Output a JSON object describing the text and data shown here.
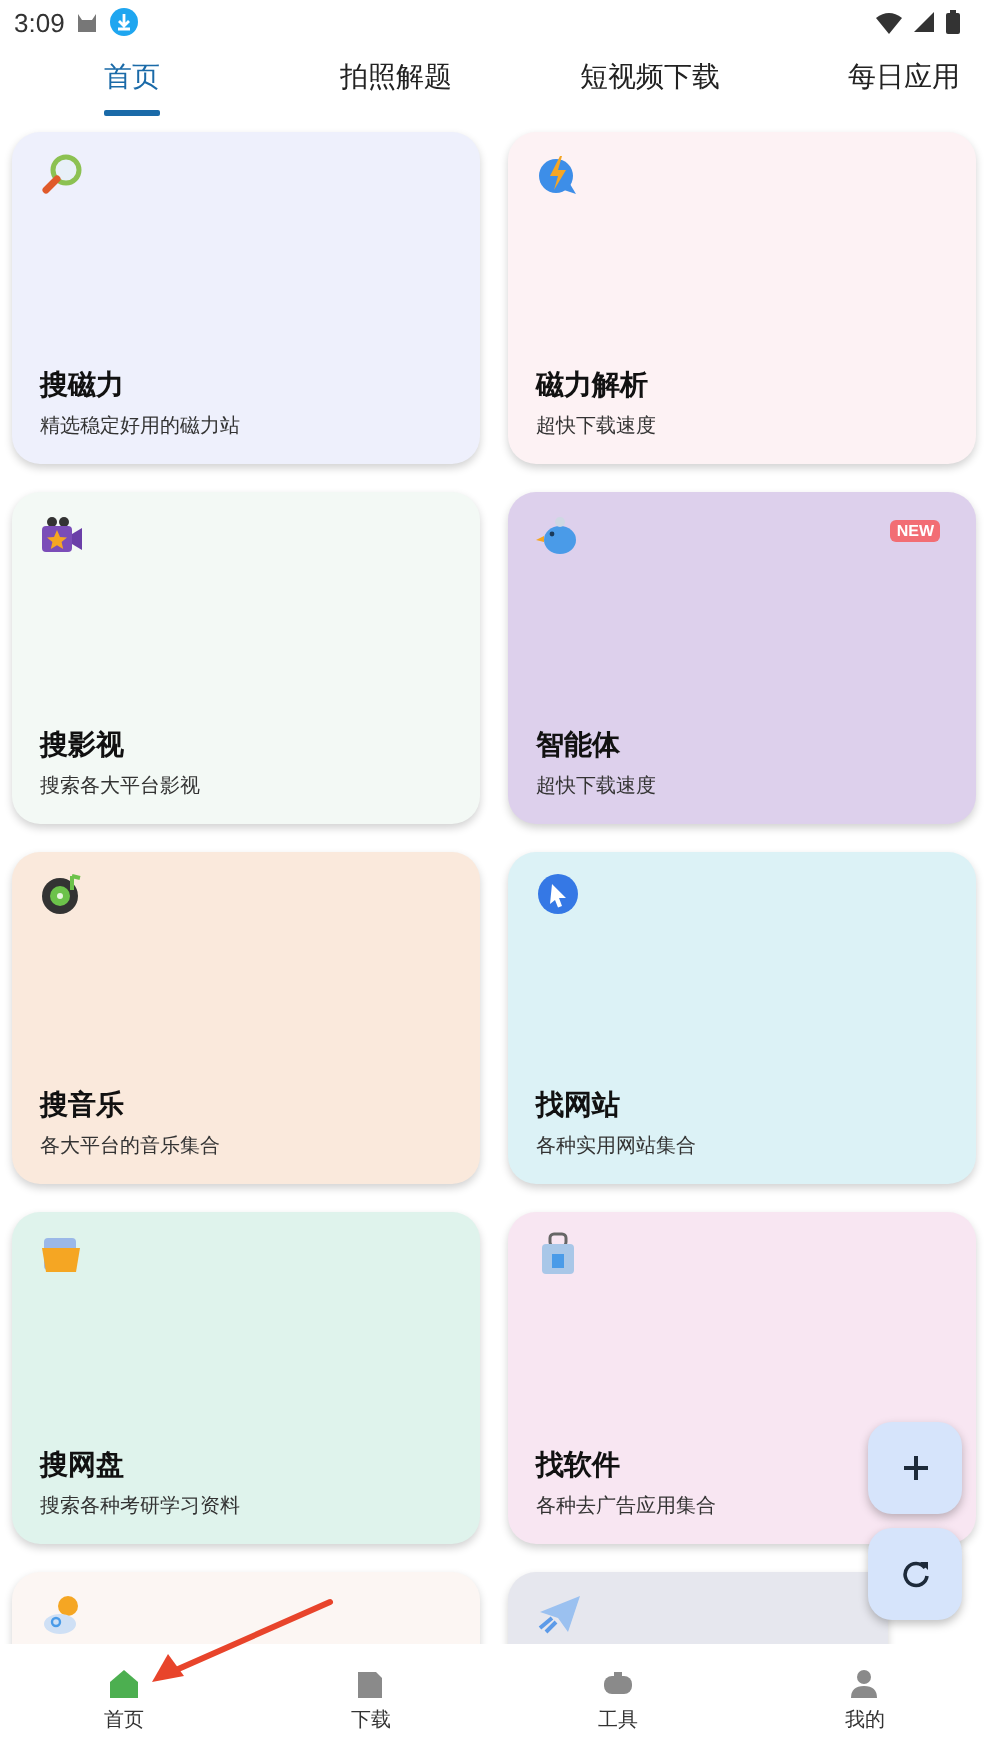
{
  "status_bar": {
    "time": "3:09"
  },
  "tabs": [
    {
      "label": "首页",
      "selected": true
    },
    {
      "label": "拍照解题",
      "selected": false
    },
    {
      "label": "短视频下载",
      "selected": false
    },
    {
      "label": "每日应用",
      "selected": false
    }
  ],
  "card_rows": [
    {
      "cards": [
        {
          "title": "搜磁力",
          "subtitle": "精选稳定好用的磁力站",
          "color": "#eef0fc"
        },
        {
          "title": "磁力解析",
          "subtitle": "超快下载速度",
          "color": "#fdf2f4"
        }
      ]
    },
    {
      "cards": [
        {
          "title": "搜影视",
          "subtitle": "搜索各大平台影视",
          "color": "#f3f9f5"
        },
        {
          "title": "智能体",
          "subtitle": "超快下载速度",
          "color": "#ddd0ec",
          "badge": "NEW"
        }
      ]
    },
    {
      "cards": [
        {
          "title": "搜音乐",
          "subtitle": "各大平台的音乐集合",
          "color": "#fae9dc"
        },
        {
          "title": "找网站",
          "subtitle": "各种实用网站集合",
          "color": "#dcf2f6"
        }
      ]
    },
    {
      "cards": [
        {
          "title": "搜网盘",
          "subtitle": "搜索各种考研学习资料",
          "color": "#dff3ec"
        },
        {
          "title": "找软件",
          "subtitle": "各种去广告应用集合",
          "color": "#f8e6f2"
        }
      ]
    },
    {
      "cards": [
        {
          "color": "#fcf6f3"
        },
        {
          "color": "#e6e7ee"
        }
      ]
    }
  ],
  "bottom_nav": [
    {
      "label": "首页",
      "selected": true
    },
    {
      "label": "下载",
      "selected": false
    },
    {
      "label": "工具",
      "selected": false
    },
    {
      "label": "我的",
      "selected": false
    }
  ]
}
